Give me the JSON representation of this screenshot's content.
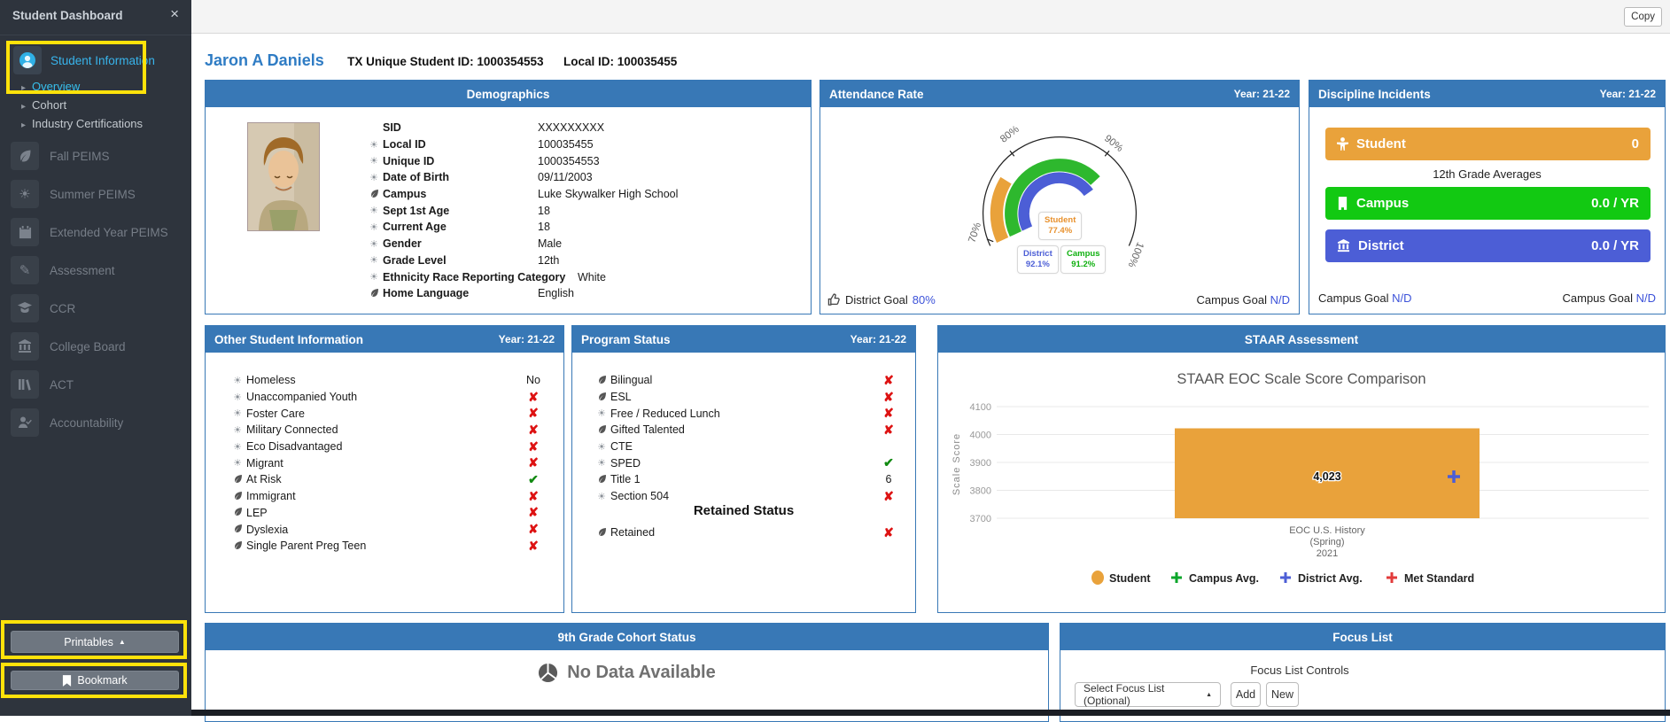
{
  "colors": {
    "panel_header": "#3878b6",
    "accent_cyan": "#38b4ec",
    "orange": "#e9a23b",
    "green": "#12c912",
    "gauge_green": "#2eb82e",
    "blue": "#4c5ed6",
    "red_x": "#dd1212",
    "check_green": "#128a12",
    "link_blue": "#3c52d9",
    "name_blue": "#2f7cc4",
    "highlight_yellow": "#ffe20a",
    "sidebar_bg": "#2e343d"
  },
  "window": {
    "copy_button": "Copy"
  },
  "sidebar": {
    "title": "Student Dashboard",
    "close_icon": "×",
    "student_information": "Student Information",
    "subitems": [
      {
        "label": "Overview"
      },
      {
        "label": "Cohort"
      },
      {
        "label": "Industry Certifications"
      }
    ],
    "items": [
      {
        "label": "Fall PEIMS"
      },
      {
        "label": "Summer PEIMS"
      },
      {
        "label": "Extended Year PEIMS"
      },
      {
        "label": "Assessment"
      },
      {
        "label": "CCR"
      },
      {
        "label": "College Board"
      },
      {
        "label": "ACT"
      },
      {
        "label": "Accountability"
      }
    ],
    "printables_label": "Printables",
    "printables_caret": "▲",
    "bookmark_label": "Bookmark"
  },
  "student_header": {
    "name": "Jaron A Daniels",
    "unique_id": "TX Unique Student ID: 1000354553",
    "local_id": "Local ID: 100035455"
  },
  "panels": {
    "demographics": {
      "title": "Demographics",
      "fields": [
        {
          "icon": "none",
          "label": "SID",
          "value": "XXXXXXXXX"
        },
        {
          "icon": "summer-icon",
          "label": "Local ID",
          "value": "100035455"
        },
        {
          "icon": "summer-icon",
          "label": "Unique ID",
          "value": "1000354553"
        },
        {
          "icon": "summer-icon",
          "label": "Date of Birth",
          "value": "09/11/2003"
        },
        {
          "icon": "fall-icon",
          "label": "Campus",
          "value": "Luke Skywalker High School"
        },
        {
          "icon": "summer-icon",
          "label": "Sept 1st Age",
          "value": "18"
        },
        {
          "icon": "summer-icon",
          "label": "Current Age",
          "value": "18"
        },
        {
          "icon": "summer-icon",
          "label": "Gender",
          "value": "Male"
        },
        {
          "icon": "summer-icon",
          "label": "Grade Level",
          "value": "12th"
        },
        {
          "icon": "summer-icon",
          "label": "Ethnicity Race Reporting Category",
          "value": "White"
        },
        {
          "icon": "fall-icon",
          "label": "Home Language",
          "value": "English"
        }
      ]
    },
    "attendance": {
      "title": "Attendance Rate",
      "year": "Year: 21-22",
      "ticks": [
        "70%",
        "80%",
        "90%",
        "100%"
      ],
      "boxes": {
        "student": {
          "label": "Student",
          "value": "77.4%"
        },
        "district": {
          "label": "District",
          "value": "92.1%"
        },
        "campus": {
          "label": "Campus",
          "value": "91.2%"
        }
      },
      "footer_left_label": "District Goal",
      "footer_left_value": "80%",
      "footer_right_label": "Campus Goal",
      "footer_right_value": "N/D",
      "chart_data": {
        "type": "gauge",
        "min": 70,
        "max": 100,
        "unit": "%",
        "series": [
          {
            "name": "Student",
            "value": 77.4,
            "color": "#e9a23b"
          },
          {
            "name": "Campus",
            "value": 91.2,
            "color": "#2eb82e"
          },
          {
            "name": "District",
            "value": 92.1,
            "color": "#4c5ed6"
          }
        ]
      }
    },
    "discipline": {
      "title": "Discipline Incidents",
      "year": "Year: 21-22",
      "rows": [
        {
          "label": "Student",
          "value": "0"
        },
        {
          "label": "Campus",
          "value": "0.0 / YR"
        },
        {
          "label": "District",
          "value": "0.0 / YR"
        }
      ],
      "middle_note": "12th Grade Averages",
      "footer_left_label": "Campus Goal",
      "footer_left_value": "N/D",
      "footer_right_label": "Campus Goal",
      "footer_right_value": "N/D"
    },
    "other_info": {
      "title": "Other Student Information",
      "year": "Year: 21-22",
      "rows": [
        {
          "icon": "summer-icon",
          "label": "Homeless",
          "value": "No"
        },
        {
          "icon": "summer-icon",
          "label": "Unaccompanied Youth",
          "value": "✘"
        },
        {
          "icon": "summer-icon",
          "label": "Foster Care",
          "value": "✘"
        },
        {
          "icon": "summer-icon",
          "label": "Military Connected",
          "value": "✘"
        },
        {
          "icon": "summer-icon",
          "label": "Eco Disadvantaged",
          "value": "✘"
        },
        {
          "icon": "summer-icon",
          "label": "Migrant",
          "value": "✘"
        },
        {
          "icon": "fall-icon",
          "label": "At Risk",
          "value": "✔"
        },
        {
          "icon": "fall-icon",
          "label": "Immigrant",
          "value": "✘"
        },
        {
          "icon": "fall-icon",
          "label": "LEP",
          "value": "✘"
        },
        {
          "icon": "fall-icon",
          "label": "Dyslexia",
          "value": "✘"
        },
        {
          "icon": "fall-icon",
          "label": "Single Parent Preg Teen",
          "value": "✘"
        }
      ]
    },
    "program_status": {
      "title": "Program Status",
      "year": "Year: 21-22",
      "rows": [
        {
          "icon": "fall-icon",
          "label": "Bilingual",
          "value": "✘"
        },
        {
          "icon": "fall-icon",
          "label": "ESL",
          "value": "✘"
        },
        {
          "icon": "summer-icon",
          "label": "Free / Reduced Lunch",
          "value": "✘"
        },
        {
          "icon": "fall-icon",
          "label": "Gifted Talented",
          "value": "✘"
        },
        {
          "icon": "summer-icon",
          "label": "CTE",
          "value": ""
        },
        {
          "icon": "summer-icon",
          "label": "SPED",
          "value": "✔"
        },
        {
          "icon": "fall-icon",
          "label": "Title 1",
          "value": "6"
        },
        {
          "icon": "summer-icon",
          "label": "Section 504",
          "value": "✘"
        }
      ],
      "retained_heading": "Retained Status",
      "retained_row": {
        "icon": "fall-icon",
        "label": "Retained",
        "value": "✘"
      }
    },
    "staar": {
      "title": "STAAR Assessment",
      "chart_title": "STAAR EOC Scale Score Comparison",
      "ylabel": "Scale Score",
      "yticks": [
        "4100",
        "4000",
        "3900",
        "3800",
        "3700"
      ],
      "bar_label": "4,023",
      "xlabel_lines": [
        "EOC U.S. History",
        "(Spring)",
        "2021"
      ],
      "legend": [
        {
          "label": "Student"
        },
        {
          "label": "Campus Avg."
        },
        {
          "label": "District Avg."
        },
        {
          "label": "Met Standard"
        }
      ],
      "chart_data": {
        "type": "bar",
        "categories": [
          "EOC U.S. History (Spring) 2021"
        ],
        "series": [
          {
            "name": "Student",
            "values": [
              4023
            ],
            "color": "#e9a23b"
          },
          {
            "name": "District Avg.",
            "values": [
              3855
            ],
            "color": "#4c5ed6",
            "marker": "plus"
          }
        ],
        "title": "STAAR EOC Scale Score Comparison",
        "xlabel": "",
        "ylabel": "Scale Score",
        "ylim": [
          3700,
          4100
        ],
        "grid": true,
        "legend_position": "bottom",
        "legend_entries": [
          "Student",
          "Campus Avg.",
          "District Avg.",
          "Met Standard"
        ]
      }
    },
    "cohort": {
      "title": "9th Grade Cohort Status",
      "empty_text": "No Data Available"
    },
    "focus": {
      "title": "Focus List",
      "controls_label": "Focus List Controls",
      "select_value": "Select Focus List (Optional)",
      "select_caret": "▲",
      "add_label": "Add",
      "new_label": "New"
    }
  }
}
